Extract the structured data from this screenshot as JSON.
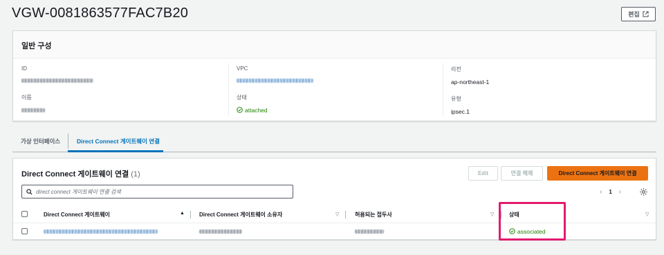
{
  "page": {
    "title": "VGW-0081863577FAC7B20",
    "edit_label": "편집"
  },
  "general": {
    "header": "일반 구성",
    "id_label": "ID",
    "name_label": "이름",
    "vpc_label": "VPC",
    "state_label": "상태",
    "state_value": "attached",
    "region_label": "리전",
    "region_value": "ap-northeast-1",
    "type_label": "유형",
    "type_value": "ipsec.1"
  },
  "tabs": {
    "virtual_interfaces": "가상 인터페이스",
    "dx_gateway_assoc": "Direct Connect 게이트웨이 연결"
  },
  "assoc_panel": {
    "title": "Direct Connect 게이트웨이 연결",
    "count": "(1)",
    "edit_button": "Edit",
    "detach_button": "연결 해제",
    "primary_button": "Direct Connect 게이트웨이 연결",
    "search_placeholder": "direct connect 게이트웨이 연결 검색",
    "page_number": "1",
    "columns": {
      "gateway": "Direct Connect 게이트웨이",
      "owner": "Direct Connect 게이트웨이 소유자",
      "allowed_prefixes": "허용되는 접두사",
      "state": "상태"
    },
    "row": {
      "state": "associated"
    }
  },
  "colors": {
    "primary": "#ec7211",
    "link": "#0073bb",
    "success": "#1d8102",
    "highlight": "#e3196e"
  }
}
